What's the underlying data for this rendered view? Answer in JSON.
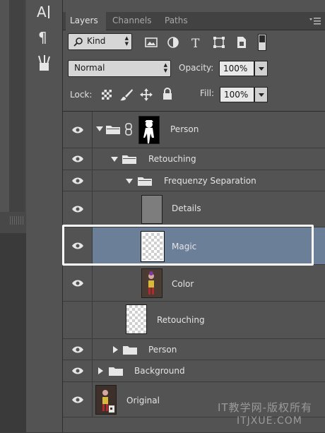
{
  "panel": {
    "tabs": [
      {
        "label": "Layers",
        "active": true
      },
      {
        "label": "Channels",
        "active": false
      },
      {
        "label": "Paths",
        "active": false
      }
    ],
    "filter": {
      "kind_label": "Kind"
    },
    "blend_mode": "Normal",
    "opacity_label": "Opacity:",
    "opacity_value": "100%",
    "lock_label": "Lock:",
    "fill_label": "Fill:",
    "fill_value": "100%"
  },
  "layers": [
    {
      "name": "Person",
      "type": "group-with-mask",
      "expanded": true,
      "visible": true,
      "selected": false
    },
    {
      "name": "Retouching",
      "type": "group",
      "expanded": true,
      "visible": true,
      "selected": false
    },
    {
      "name": "Frequenzy Separation",
      "type": "group",
      "expanded": true,
      "visible": true,
      "selected": false
    },
    {
      "name": "Details",
      "type": "layer",
      "visible": true,
      "selected": false
    },
    {
      "name": "Magic",
      "type": "layer",
      "visible": true,
      "selected": true
    },
    {
      "name": "Color",
      "type": "layer",
      "visible": true,
      "selected": false
    },
    {
      "name": "Retouching",
      "type": "layer",
      "visible": false,
      "selected": false
    },
    {
      "name": "Person",
      "type": "group",
      "expanded": false,
      "visible": true,
      "selected": false
    },
    {
      "name": "Background",
      "type": "group",
      "expanded": false,
      "visible": true,
      "selected": false
    },
    {
      "name": "Original",
      "type": "layer",
      "visible": true,
      "selected": false
    }
  ],
  "watermark": {
    "line1": "IT教学网-版权所有",
    "line2": "ITJXUE.COM"
  },
  "colors": {
    "selected_row": "#6c7f99",
    "panel_bg": "#535353",
    "highlight_border": "#ffffff"
  }
}
